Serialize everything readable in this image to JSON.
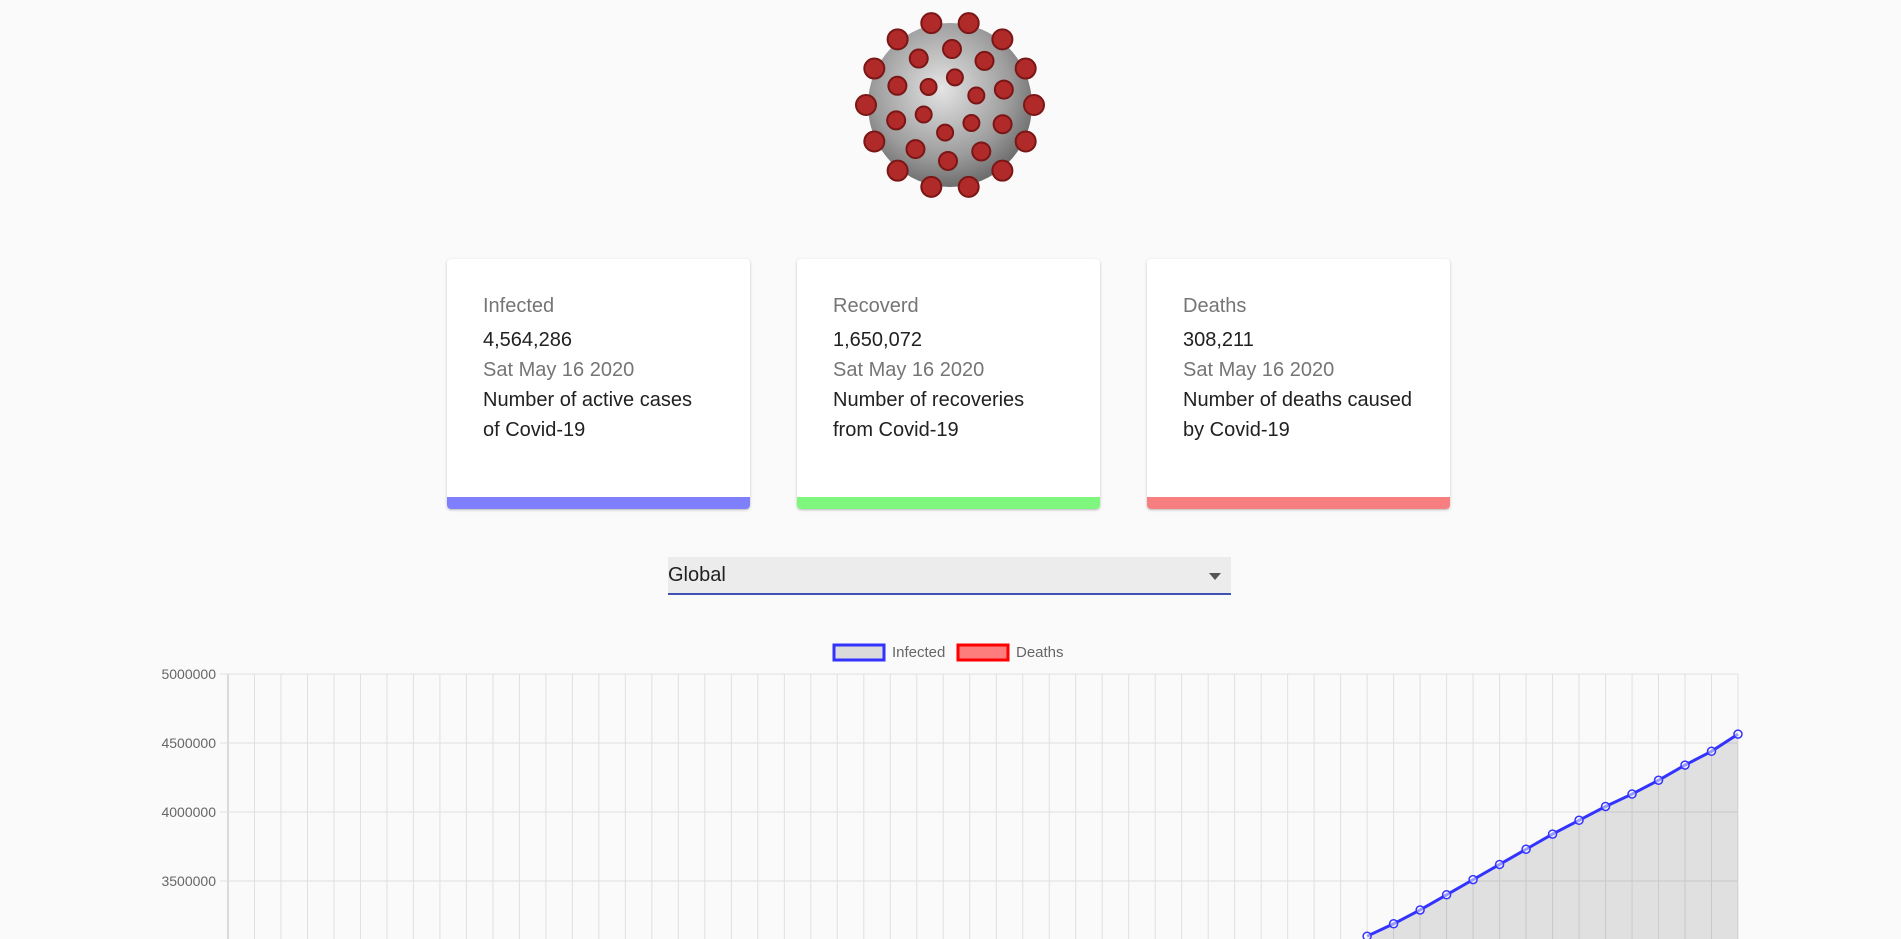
{
  "header": {
    "image_name": "coronavirus-image"
  },
  "cards": [
    {
      "title": "Infected",
      "value": "4,564,286",
      "date": "Sat May 16 2020",
      "description": "Number of active cases of Covid-19",
      "color": "#7f7ffb"
    },
    {
      "title": "Recoverd",
      "value": "1,650,072",
      "date": "Sat May 16 2020",
      "description": "Number of recoveries from Covid-19",
      "color": "#7ff77f"
    },
    {
      "title": "Deaths",
      "value": "308,211",
      "date": "Sat May 16 2020",
      "description": "Number of deaths caused by Covid-19",
      "color": "#f77f7f"
    }
  ],
  "country_select": {
    "selected": "Global"
  },
  "chart_data": {
    "type": "line",
    "legend": [
      {
        "name": "Infected",
        "border": "#3333ff",
        "fill": "rgba(0,0,0,0.12)"
      },
      {
        "name": "Deaths",
        "border": "#ff0000",
        "fill": "rgba(255,0,0,0.5)"
      }
    ],
    "legend_position": "top",
    "y_ticks": [
      "5000000",
      "4500000",
      "4000000",
      "3500000"
    ],
    "ylim_visible": [
      3100000,
      5000000
    ],
    "grid": true,
    "x_count": 58,
    "series": [
      {
        "name": "Infected",
        "color": "#3333ff",
        "fill": true,
        "visible_tail": [
          3100000,
          3190000,
          3290000,
          3400000,
          3510000,
          3620000,
          3730000,
          3840000,
          3940000,
          4040000,
          4130000,
          4230000,
          4340000,
          4440000,
          4564286
        ]
      },
      {
        "name": "Deaths",
        "color": "#ff0000",
        "fill": true,
        "visible_tail": []
      }
    ]
  }
}
